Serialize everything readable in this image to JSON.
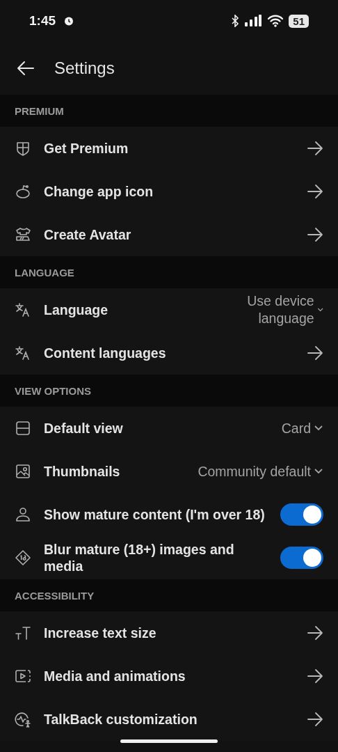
{
  "status_bar": {
    "time": "1:45",
    "battery": "51"
  },
  "header": {
    "title": "Settings"
  },
  "sections": [
    {
      "title": "PREMIUM",
      "items": [
        {
          "kind": "link",
          "label": "Get Premium"
        },
        {
          "kind": "link",
          "label": "Change app icon"
        },
        {
          "kind": "link",
          "label": "Create Avatar"
        }
      ]
    },
    {
      "title": "LANGUAGE",
      "items": [
        {
          "kind": "dropdown",
          "label": "Language",
          "value": "Use device language"
        },
        {
          "kind": "link",
          "label": "Content languages"
        }
      ]
    },
    {
      "title": "VIEW OPTIONS",
      "items": [
        {
          "kind": "dropdown",
          "label": "Default view",
          "value": "Card"
        },
        {
          "kind": "dropdown",
          "label": "Thumbnails",
          "value": "Community default"
        },
        {
          "kind": "toggle",
          "label": "Show mature content (I'm over 18)",
          "on": true
        },
        {
          "kind": "toggle",
          "label": "Blur mature (18+) images and media",
          "on": true
        }
      ]
    },
    {
      "title": "ACCESSIBILITY",
      "items": [
        {
          "kind": "link",
          "label": "Increase text size"
        },
        {
          "kind": "link",
          "label": "Media and animations"
        },
        {
          "kind": "link",
          "label": "TalkBack customization"
        }
      ]
    }
  ]
}
